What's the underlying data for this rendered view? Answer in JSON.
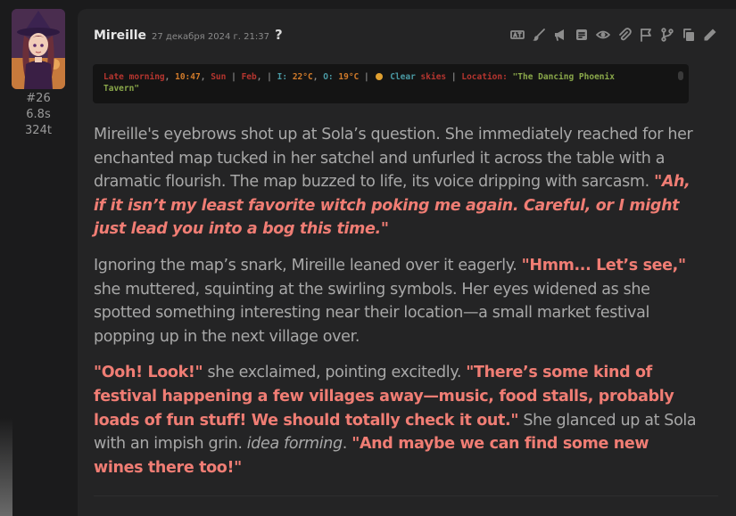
{
  "sidebar": {
    "avatar_alt": "Mireille avatar",
    "message_number": "#26",
    "gen_time": "6.8s",
    "token_count": "324t"
  },
  "header": {
    "name": "Mireille",
    "timestamp": "27 декабря 2024 г. 21:37",
    "help": "?"
  },
  "toolbar": {
    "icons": [
      "translate-icon",
      "brush-icon",
      "megaphone-icon",
      "summary-icon",
      "eye-icon",
      "paperclip-icon",
      "flag-icon",
      "branch-icon",
      "copy-icon",
      "pencil-icon"
    ]
  },
  "status": {
    "time_label": "Late morning",
    "sep1": ",",
    "time": "10:47",
    "sep2": ",",
    "day": "Sun",
    "sep3": "|",
    "month": "Feb",
    "sep4": ", |",
    "indoor_label": "I:",
    "indoor_temp": "22°C",
    "sep5": ",",
    "outdoor_label": "O:",
    "outdoor_temp": "19°C",
    "sep6": "|",
    "weather_a": "Clear",
    "weather_b": "skies",
    "sep7": "|",
    "location_label": "Location:",
    "location_value_1": "\"The Dancing Phoenix",
    "location_value_2": "Tavern\""
  },
  "message": {
    "p1_text": "Mireille's eyebrows shot up at Sola’s question. She immediately reached for her enchanted map tucked in her satchel and unfurled it across the table with a dramatic flourish. The map buzzed to life, its voice dripping with sarcasm. ",
    "p1_speech": "\"Ah, if it isn’t my least favorite witch poking me again. Careful, or I might just lead you into a bog this time.\"",
    "p2_text_a": "Ignoring the map’s snark, Mireille leaned over it eagerly. ",
    "p2_speech": "\"Hmm... Let’s see,\"",
    "p2_text_b": " she muttered, squinting at the swirling symbols. Her eyes widened as she spotted something interesting near their location—a small market festival popping up in the next village over.",
    "p3_speech_a": "\"Ooh! Look!\"",
    "p3_text_a": " she exclaimed, pointing excitedly. ",
    "p3_speech_b": "\"There’s some kind of festival happening a few villages away—music, food stalls, probably loads of fun stuff! We should totally check it out.\"",
    "p3_text_b": " She glanced up at Sola with an impish grin. ",
    "p3_thought": "idea forming",
    "p3_text_c": ". ",
    "p3_speech_c": "\"And maybe we can find some new wines there too!\""
  }
}
